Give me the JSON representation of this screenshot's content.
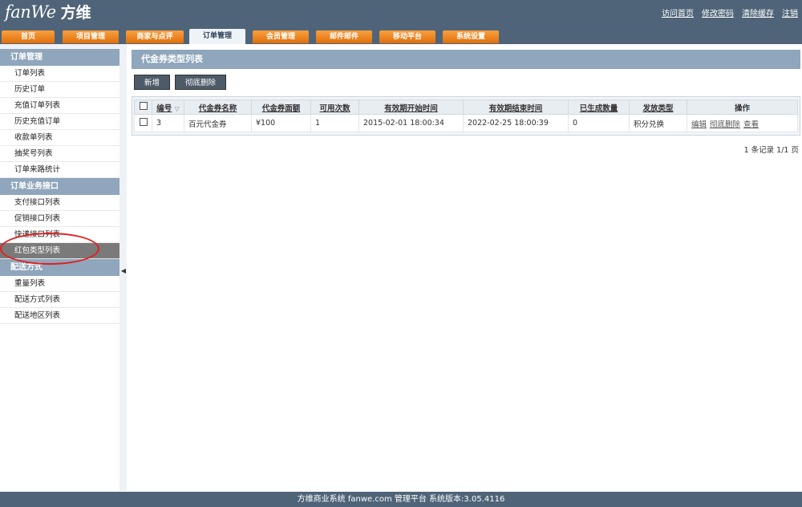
{
  "header": {
    "logo_en": "fanWe",
    "logo_cn": "方维",
    "links": [
      "访问首页",
      "修改密码",
      "清除缓存",
      "注销"
    ]
  },
  "nav": {
    "tabs": [
      {
        "label": "首页",
        "active": false
      },
      {
        "label": "项目管理",
        "active": false
      },
      {
        "label": "商家与点评",
        "active": false
      },
      {
        "label": "订单管理",
        "active": true
      },
      {
        "label": "会员管理",
        "active": false
      },
      {
        "label": "邮件邮件",
        "active": false
      },
      {
        "label": "移动平台",
        "active": false
      },
      {
        "label": "系统设置",
        "active": false
      }
    ]
  },
  "sidebar": {
    "groups": [
      {
        "title": "订单管理",
        "items": [
          "订单列表",
          "历史订单",
          "充值订单列表",
          "历史充值订单",
          "收款单列表",
          "抽奖号列表",
          "订单来路统计"
        ]
      },
      {
        "title": "订单业务接口",
        "items": [
          "支付接口列表",
          "促销接口列表",
          "快递接口列表",
          "红包类型列表"
        ]
      },
      {
        "title": "配送方式",
        "items": [
          "重量列表",
          "配送方式列表",
          "配送地区列表"
        ]
      }
    ],
    "active_item": "红包类型列表"
  },
  "main": {
    "title": "代金券类型列表",
    "buttons": {
      "add": "新增",
      "delete": "彻底删除"
    },
    "table": {
      "headers": [
        "编号",
        "代金券名称",
        "代金券面额",
        "可用次数",
        "有效期开始时间",
        "有效期结束时间",
        "已生成数量",
        "发放类型",
        "操作"
      ],
      "rows": [
        {
          "id": "3",
          "name": "百元代金券",
          "amount": "¥100",
          "uses": "1",
          "start": "2015-02-01 18:00:34",
          "end": "2022-02-25 18:00:39",
          "generated": "0",
          "type": "积分兑换",
          "actions": [
            "编辑",
            "彻底删除",
            "查看"
          ]
        }
      ]
    },
    "pager": "1 条记录 1/1 页"
  },
  "footer": {
    "text": "方维商业系统 fanwe.com 管理平台 系统版本:3.05.4116"
  }
}
